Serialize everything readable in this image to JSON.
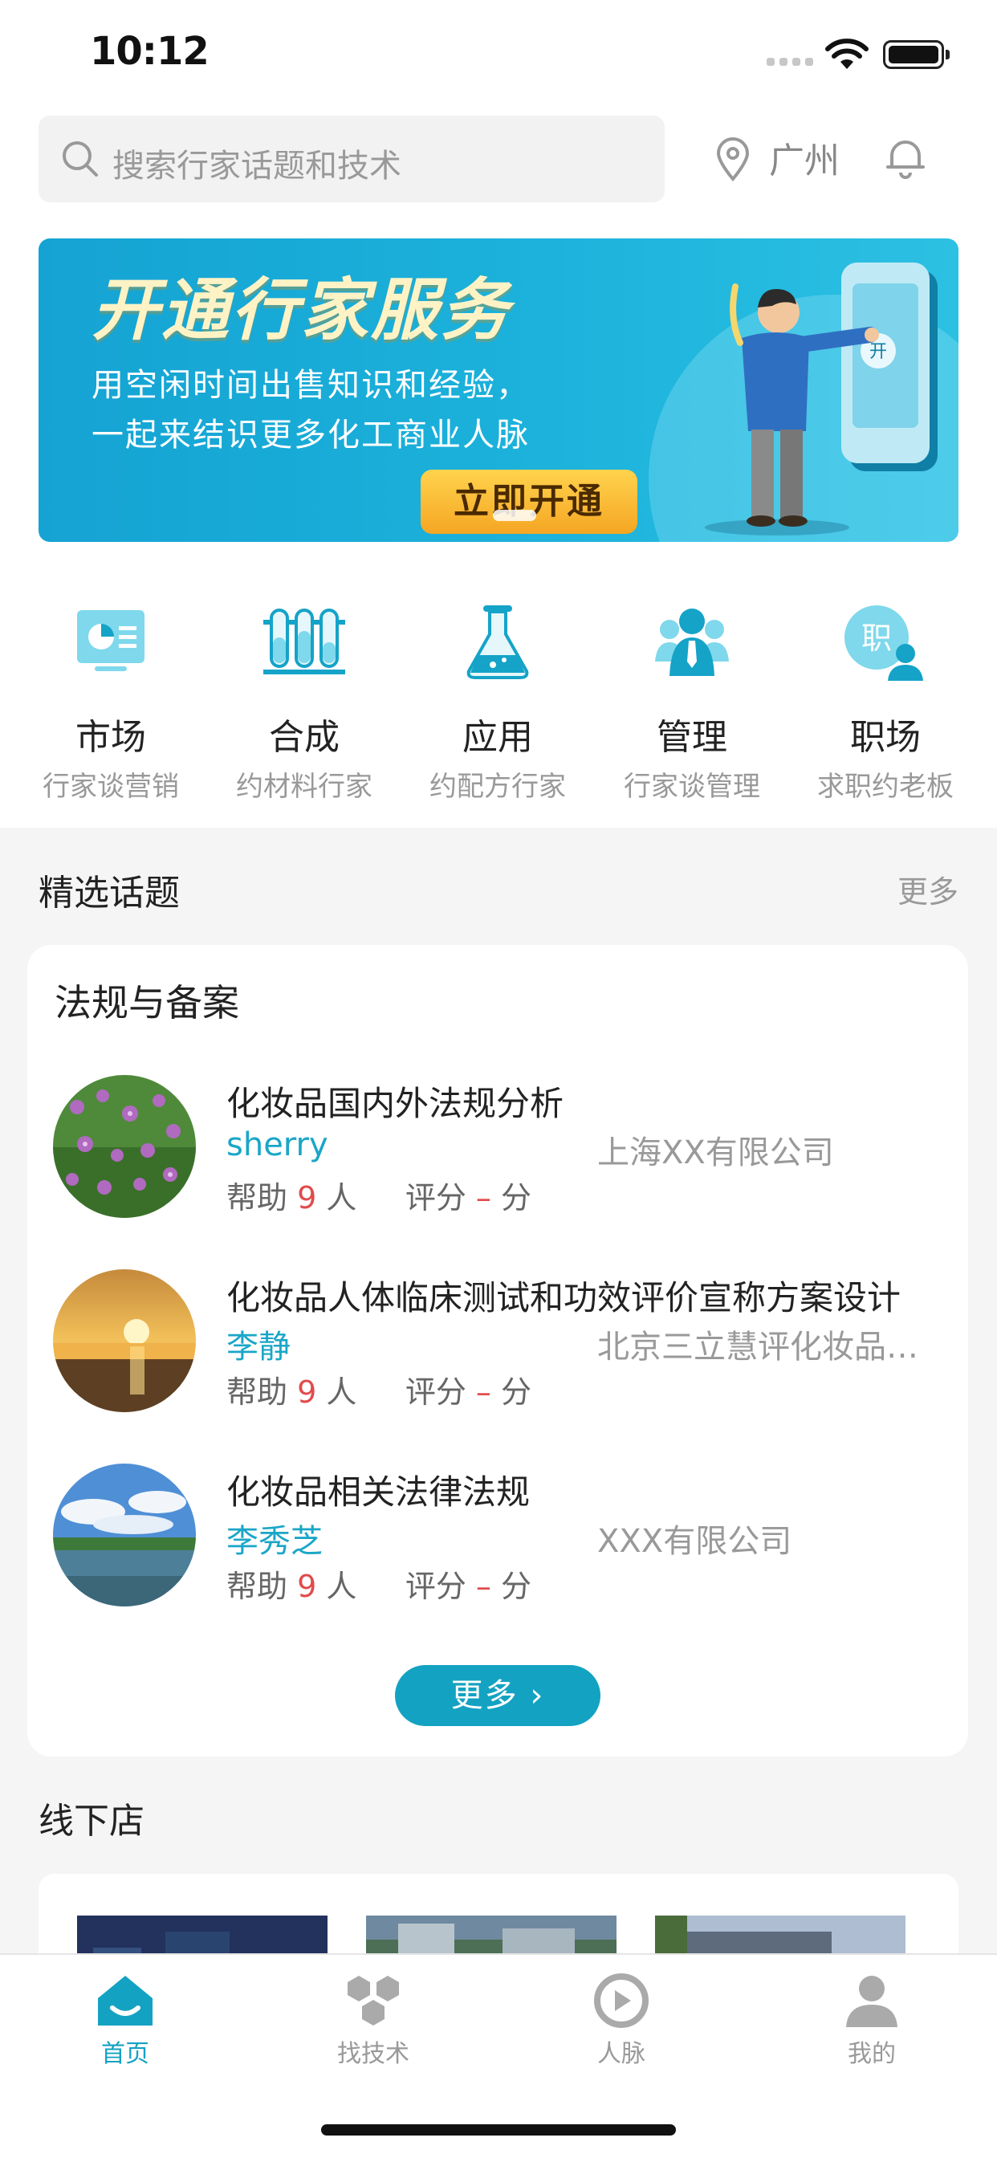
{
  "status_bar": {
    "time": "10:12"
  },
  "header": {
    "search_placeholder": "搜索行家话题和技术",
    "city": "广州"
  },
  "banner": {
    "title": "开通行家服务",
    "line1": "用空闲时间出售知识和经验，",
    "line2": "一起来结识更多化工商业人脉",
    "button": "立即开通"
  },
  "categories": [
    {
      "name": "市场",
      "sub": "行家谈营销",
      "icon": "market-board-icon"
    },
    {
      "name": "合成",
      "sub": "约材料行家",
      "icon": "test-tubes-icon"
    },
    {
      "name": "应用",
      "sub": "约配方行家",
      "icon": "flask-icon"
    },
    {
      "name": "管理",
      "sub": "行家谈管理",
      "icon": "team-icon"
    },
    {
      "name": "职场",
      "sub": "求职约老板",
      "icon": "job-person-icon",
      "badge": "职"
    }
  ],
  "featured": {
    "title": "精选话题",
    "more": "更多",
    "card_title": "法规与备案",
    "items": [
      {
        "title": "化妆品国内外法规分析",
        "user": "sherry",
        "company": "上海XX有限公司",
        "help_prefix": "帮助",
        "help_count": "9",
        "help_suffix": "人",
        "rating_prefix": "评分",
        "rating": "–",
        "rating_suffix": "分"
      },
      {
        "title": "化妆品人体临床测试和功效评价宣称方案设计",
        "user": "李静",
        "company": "北京三立慧评化妆品科技有限公司",
        "help_prefix": "帮助",
        "help_count": "9",
        "help_suffix": "人",
        "rating_prefix": "评分",
        "rating": "–",
        "rating_suffix": "分"
      },
      {
        "title": "化妆品相关法律法规",
        "user": "李秀芝",
        "company": "XXX有限公司",
        "help_prefix": "帮助",
        "help_count": "9",
        "help_suffix": "人",
        "rating_prefix": "评分",
        "rating": "–",
        "rating_suffix": "分"
      }
    ],
    "more_button": "更多 ›"
  },
  "offline": {
    "title": "线下店"
  },
  "tabbar": [
    {
      "label": "首页",
      "icon": "home-icon",
      "active": true
    },
    {
      "label": "找技术",
      "icon": "cubes-icon",
      "active": false
    },
    {
      "label": "人脉",
      "icon": "network-icon",
      "active": false
    },
    {
      "label": "我的",
      "icon": "user-icon",
      "active": false
    }
  ],
  "colors": {
    "accent": "#14a2c2",
    "banner": "#1cb2db",
    "highlight": "#e14b4b"
  }
}
